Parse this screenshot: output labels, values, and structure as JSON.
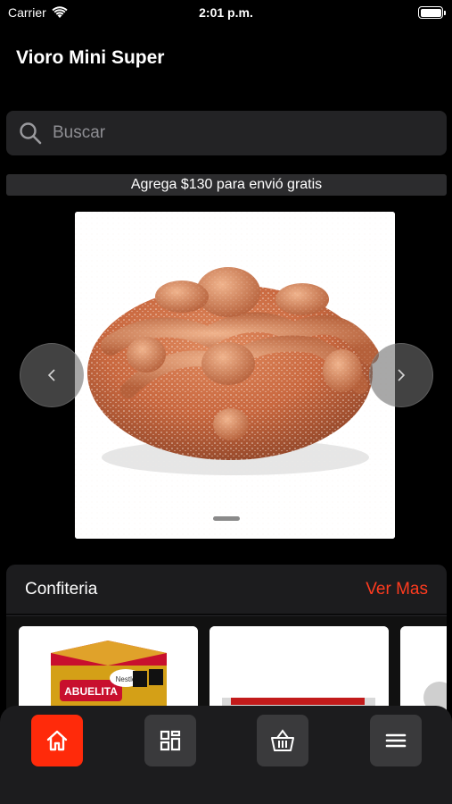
{
  "status": {
    "carrier": "Carrier",
    "time": "2:01 p.m."
  },
  "app": {
    "title": "Vioro Mini Super"
  },
  "search": {
    "placeholder": "Buscar",
    "value": ""
  },
  "promo": {
    "text": "Agrega $130 para envió gratis"
  },
  "carousel": {
    "prev_icon": "chevron-left-icon",
    "next_icon": "chevron-right-icon",
    "active_slide": 1
  },
  "category": {
    "title": "Confiteria",
    "see_more": "Ver Mas",
    "accent_color": "#ff3b1f"
  },
  "product_card_1": {
    "logo_lettering": "ABUELITA",
    "brand_lettering": "Nestlé"
  },
  "nav": {
    "items": [
      {
        "icon": "home-icon",
        "active": true,
        "color": "#ff2a0a"
      },
      {
        "icon": "grid-icon",
        "active": false
      },
      {
        "icon": "basket-icon",
        "active": false
      },
      {
        "icon": "menu-icon",
        "active": false
      }
    ]
  }
}
